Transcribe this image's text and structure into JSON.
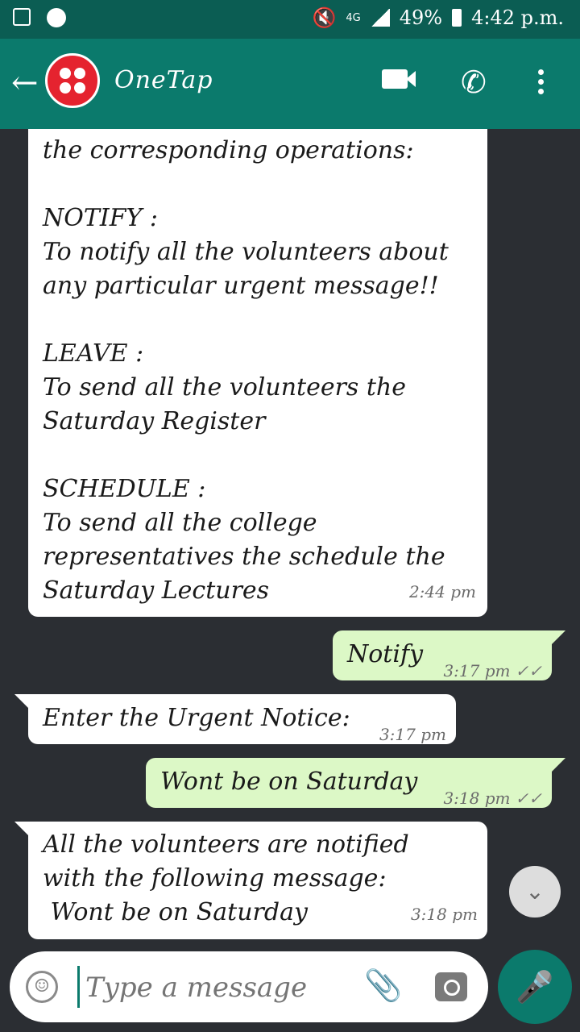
{
  "status_bar": {
    "network": "4G",
    "battery": "49%",
    "time": "4:42 p.m."
  },
  "header": {
    "back_icon": "arrow-left-icon",
    "title": "OneTap",
    "avatar_icon": "twilio-logo-icon"
  },
  "messages": [
    {
      "direction": "in",
      "lines": [
        "the corresponding operations:",
        "",
        "NOTIFY :",
        "To notify all the volunteers about",
        "any particular urgent message!!",
        "",
        "LEAVE :",
        "To send all the volunteers the",
        "Saturday Register",
        "",
        "SCHEDULE :",
        "To send all the college",
        "representatives the schedule the",
        "Saturday Lectures"
      ],
      "time": "2:44 pm"
    },
    {
      "direction": "out",
      "text": "Notify",
      "time": "3:17 pm",
      "ticks": "✓✓"
    },
    {
      "direction": "in",
      "text": "Enter the Urgent Notice:",
      "time": "3:17 pm"
    },
    {
      "direction": "out",
      "text": "Wont be on Saturday",
      "time": "3:18 pm",
      "ticks": "✓✓"
    },
    {
      "direction": "in",
      "lines": [
        "All the volunteers are notified",
        "with the following message:",
        " Wont be on Saturday"
      ],
      "time": "3:18 pm"
    }
  ],
  "input": {
    "placeholder": "Type a message"
  },
  "colors": {
    "header": "#0b7a6c",
    "statusbar": "#0b5d53",
    "outgoing_bubble": "#dcf8c6",
    "background": "#2b2e33"
  }
}
